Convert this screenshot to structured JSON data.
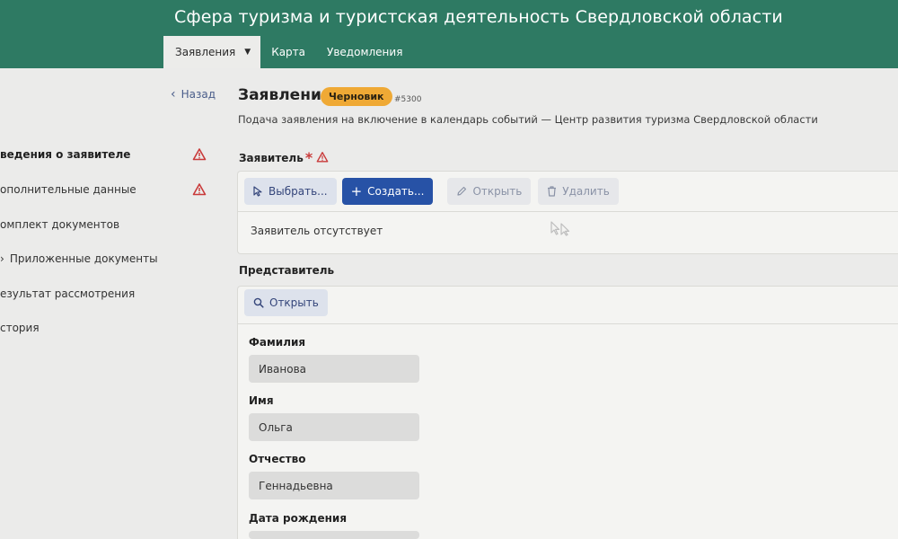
{
  "app": {
    "title": "Сфера туризма и туристская деятельность Свердловской области"
  },
  "nav": {
    "items": [
      {
        "label": "Заявления",
        "active": true,
        "dropdown": true
      },
      {
        "label": "Карта"
      },
      {
        "label": "Уведомления"
      }
    ]
  },
  "sidebar": {
    "items": [
      {
        "label": "ведения о заявителе",
        "active": true,
        "warning": true
      },
      {
        "label": "ополнительные данные",
        "warning": true
      },
      {
        "label": "омплект документов"
      },
      {
        "label": "Приложенные документы"
      },
      {
        "label": "езультат рассмотрения"
      },
      {
        "label": "стория"
      }
    ]
  },
  "header": {
    "back_label": "Назад",
    "title": "Заявление",
    "status": "Черновик",
    "number": "#5300",
    "subtitle": "Подача заявления на включение в календарь событий — Центр развития туризма Свердловской области"
  },
  "applicant": {
    "label": "Заявитель",
    "required": true,
    "buttons": {
      "select": "Выбрать...",
      "create": "Создать...",
      "open": "Открыть",
      "delete": "Удалить"
    },
    "empty_text": "Заявитель отсутствует"
  },
  "representative": {
    "label": "Представитель",
    "open_button": "Открыть",
    "fields": [
      {
        "label": "Фамилия",
        "value": "Иванова"
      },
      {
        "label": "Имя",
        "value": "Ольга"
      },
      {
        "label": "Отчество",
        "value": "Геннадьевна"
      },
      {
        "label": "Дата рождения",
        "value": ""
      }
    ]
  },
  "colors": {
    "header_bg": "#2e7a63",
    "status_badge": "#efa935",
    "primary_button": "#2752a6",
    "warning_icon": "#c93a3a"
  }
}
